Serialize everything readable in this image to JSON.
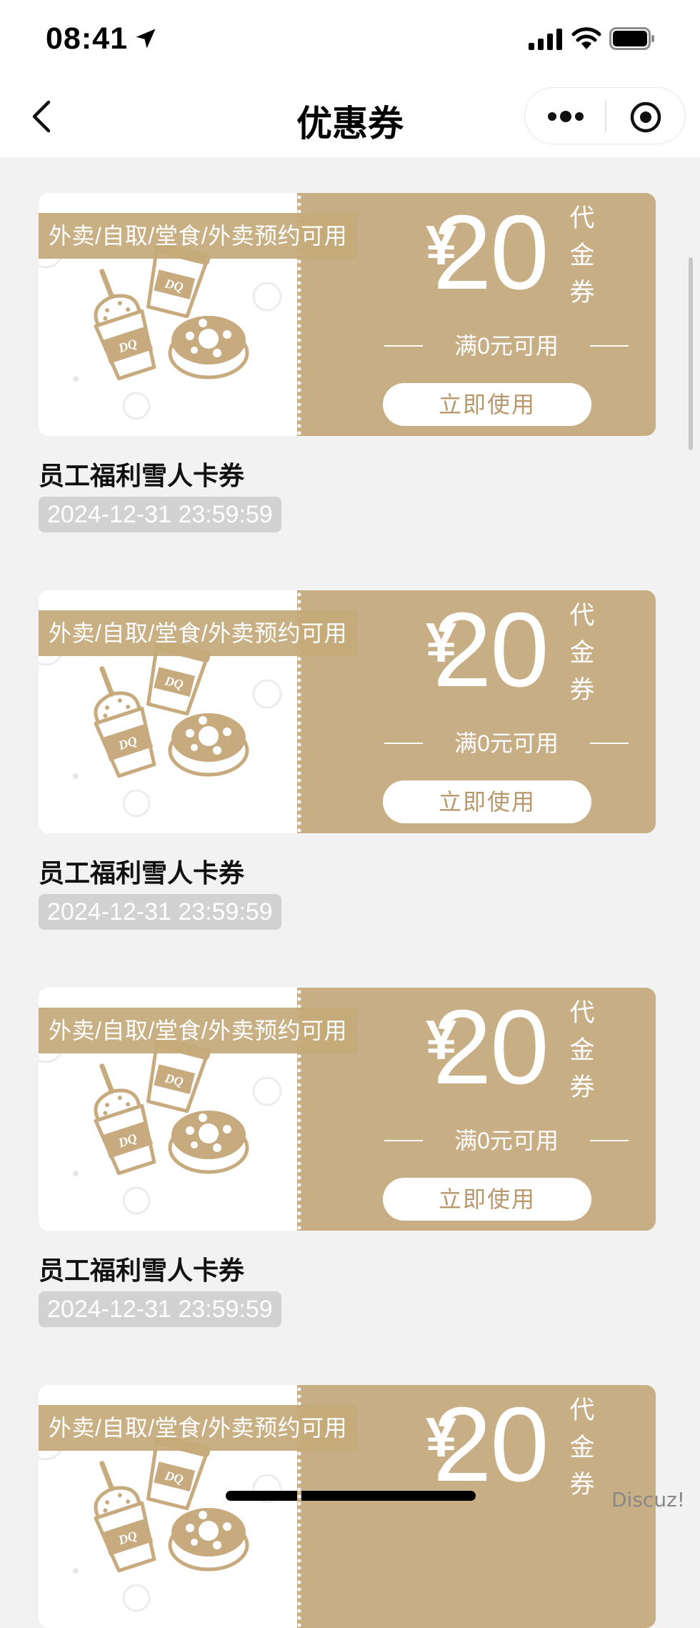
{
  "status_bar": {
    "time": "08:41"
  },
  "nav": {
    "title": "优惠券"
  },
  "coupons": [
    {
      "usage": "外卖/自取/堂食/外卖预约可用",
      "currency": "¥",
      "amount": "20",
      "unit_chars": [
        "代",
        "金",
        "券"
      ],
      "condition": "满0元可用",
      "button_label": "立即使用",
      "name": "员工福利雪人卡券",
      "expiry": "2024-12-31 23:59:59"
    },
    {
      "usage": "外卖/自取/堂食/外卖预约可用",
      "currency": "¥",
      "amount": "20",
      "unit_chars": [
        "代",
        "金",
        "券"
      ],
      "condition": "满0元可用",
      "button_label": "立即使用",
      "name": "员工福利雪人卡券",
      "expiry": "2024-12-31 23:59:59"
    },
    {
      "usage": "外卖/自取/堂食/外卖预约可用",
      "currency": "¥",
      "amount": "20",
      "unit_chars": [
        "代",
        "金",
        "券"
      ],
      "condition": "满0元可用",
      "button_label": "立即使用",
      "name": "员工福利雪人卡券",
      "expiry": "2024-12-31 23:59:59"
    },
    {
      "usage": "外卖/自取/堂食/外卖预约可用",
      "currency": "¥",
      "amount": "20",
      "unit_chars": [
        "代",
        "金",
        "券"
      ],
      "condition": "",
      "button_label": "",
      "name": "",
      "expiry": ""
    }
  ],
  "watermark": "Discuz!",
  "colors": {
    "coupon_gold": "#c8ae84",
    "tag_gold": "#c4a97a",
    "expiry_gray": "#d2d2d2",
    "page_bg": "#f2f2f2"
  }
}
